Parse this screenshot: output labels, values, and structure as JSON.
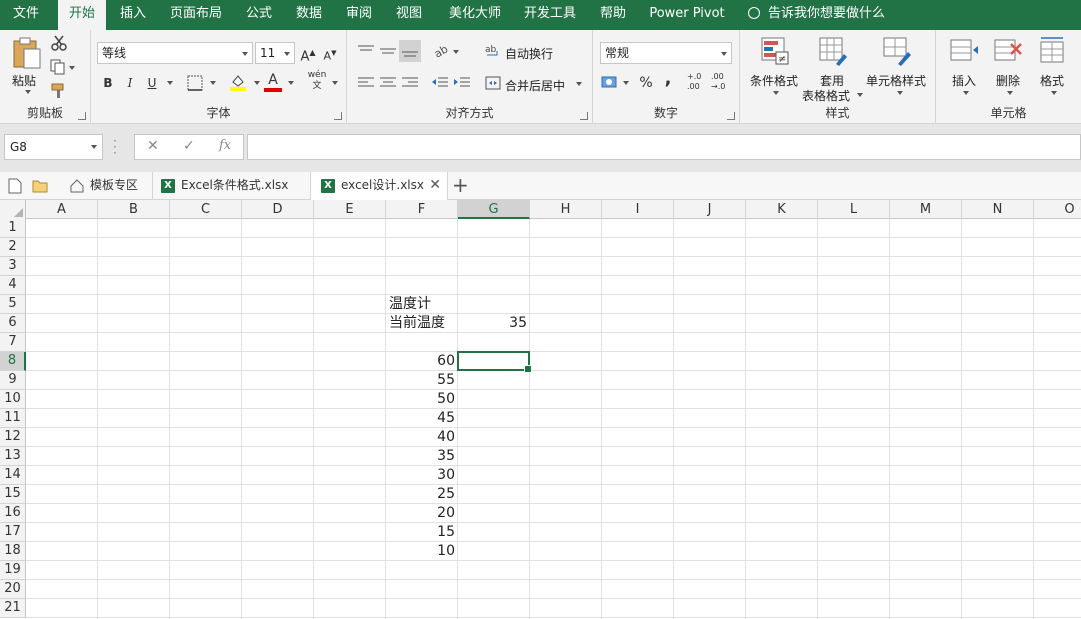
{
  "menu": {
    "tabs": [
      {
        "label": "文件",
        "active": false
      },
      {
        "label": "开始",
        "active": true
      },
      {
        "label": "插入",
        "active": false
      },
      {
        "label": "页面布局",
        "active": false
      },
      {
        "label": "公式",
        "active": false
      },
      {
        "label": "数据",
        "active": false
      },
      {
        "label": "审阅",
        "active": false
      },
      {
        "label": "视图",
        "active": false
      },
      {
        "label": "美化大师",
        "active": false
      },
      {
        "label": "开发工具",
        "active": false
      },
      {
        "label": "帮助",
        "active": false
      },
      {
        "label": "Power Pivot",
        "active": false
      }
    ],
    "tell_me": "告诉我你想要做什么"
  },
  "ribbon": {
    "clipboard": {
      "label": "剪贴板",
      "paste": "粘贴"
    },
    "font": {
      "label": "字体",
      "font_name": "等线",
      "font_size": "11",
      "bold": "B",
      "italic": "I",
      "underline": "U",
      "grow": "A",
      "shrink": "A",
      "font_color_letter": "A",
      "phonetic": "wén\n文"
    },
    "alignment": {
      "label": "对齐方式",
      "wrap_text": "自动换行",
      "merge_center": "合并后居中"
    },
    "number": {
      "label": "数字",
      "format": "常规",
      "percent": "%",
      "comma": ",",
      "inc_decimal": "+.0\n.00",
      "dec_decimal": ".00\n→.0"
    },
    "styles": {
      "label": "样式",
      "conditional": "条件格式",
      "table_line1": "套用",
      "table_line2": "表格格式",
      "cell_styles": "单元格样式"
    },
    "cells": {
      "label": "单元格",
      "insert": "插入",
      "delete": "删除",
      "format": "格式"
    }
  },
  "formula_bar": {
    "name_box": "G8",
    "cancel": "✕",
    "enter": "✓",
    "fx": "fx",
    "content": ""
  },
  "doc_tabs": [
    {
      "label": "模板专区",
      "icon": "home-icon",
      "active": false
    },
    {
      "label": "Excel条件格式.xlsx",
      "icon": "excel-icon",
      "active": false
    },
    {
      "label": "excel设计.xlsx",
      "icon": "excel-icon",
      "active": true
    }
  ],
  "grid": {
    "columns": [
      "A",
      "B",
      "C",
      "D",
      "E",
      "F",
      "G",
      "H",
      "I",
      "J",
      "K",
      "L",
      "M",
      "N",
      "O"
    ],
    "rows": [
      "1",
      "2",
      "3",
      "4",
      "5",
      "6",
      "7",
      "8",
      "9",
      "10",
      "11",
      "12",
      "13",
      "14",
      "15",
      "16",
      "17",
      "18",
      "19",
      "20",
      "21"
    ],
    "selected_cell": "G8",
    "cells": [
      {
        "ref": "F5",
        "value": "温度计",
        "type": "text"
      },
      {
        "ref": "F6",
        "value": "当前温度",
        "type": "text"
      },
      {
        "ref": "G6",
        "value": "35",
        "type": "num"
      },
      {
        "ref": "F8",
        "value": "60",
        "type": "num"
      },
      {
        "ref": "F9",
        "value": "55",
        "type": "num"
      },
      {
        "ref": "F10",
        "value": "50",
        "type": "num"
      },
      {
        "ref": "F11",
        "value": "45",
        "type": "num"
      },
      {
        "ref": "F12",
        "value": "40",
        "type": "num"
      },
      {
        "ref": "F13",
        "value": "35",
        "type": "num"
      },
      {
        "ref": "F14",
        "value": "30",
        "type": "num"
      },
      {
        "ref": "F15",
        "value": "25",
        "type": "num"
      },
      {
        "ref": "F16",
        "value": "20",
        "type": "num"
      },
      {
        "ref": "F17",
        "value": "15",
        "type": "num"
      },
      {
        "ref": "F18",
        "value": "10",
        "type": "num"
      }
    ]
  },
  "colors": {
    "accent": "#217346"
  }
}
